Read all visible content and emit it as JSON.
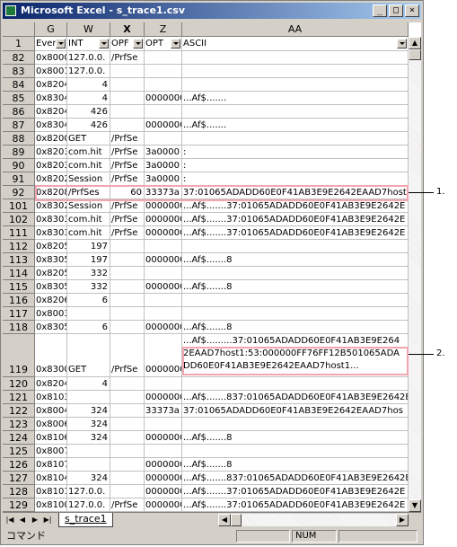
{
  "window": {
    "title": "Microsoft Excel - s_trace1.csv"
  },
  "columns": [
    {
      "label": "G",
      "selected": false
    },
    {
      "label": "W",
      "selected": false
    },
    {
      "label": "X",
      "selected": true
    },
    {
      "label": "Z",
      "selected": false
    },
    {
      "label": "AA",
      "selected": false
    }
  ],
  "header_row": {
    "num": "1",
    "cells": [
      "Even",
      "INT",
      "OPF",
      "OPT",
      "ASCII"
    ]
  },
  "rows": [
    {
      "num": "82",
      "g": "0x8000",
      "w": "127.0.0.",
      "x": "/PrfSe",
      "z": "",
      "aa": ""
    },
    {
      "num": "83",
      "g": "0x8001",
      "w": "127.0.0.",
      "x": "",
      "z": "",
      "aa": ""
    },
    {
      "num": "84",
      "g": "0x8204",
      "w": "4",
      "x": "",
      "z": "",
      "aa": ""
    },
    {
      "num": "85",
      "g": "0x8304",
      "w": "4",
      "x": "",
      "z": "0000000",
      "aa": "...Af$......."
    },
    {
      "num": "86",
      "g": "0x8204",
      "w": "426",
      "x": "",
      "z": "",
      "aa": ""
    },
    {
      "num": "87",
      "g": "0x8304",
      "w": "426",
      "x": "",
      "z": "0000000",
      "aa": "...Af$......."
    },
    {
      "num": "88",
      "g": "0x8200",
      "w": "GET",
      "x": "/PrfSe",
      "z": "",
      "aa": ""
    },
    {
      "num": "89",
      "g": "0x8203",
      "w": "com.hit",
      "x": "/PrfSe",
      "z": "3a0000",
      "aa": ":"
    },
    {
      "num": "90",
      "g": "0x8203",
      "w": "com.hit",
      "x": "/PrfSe",
      "z": "3a0000",
      "aa": ":"
    },
    {
      "num": "91",
      "g": "0x8202",
      "w": "Session",
      "x": "/PrfSe",
      "z": "3a0000",
      "aa": ":"
    },
    {
      "num": "92",
      "g": "0x8208",
      "w": "/PrfSes",
      "x": "60",
      "z": "33373a",
      "aa": "37:01065ADADD60E0F41AB3E9E2642EAAD7host"
    },
    {
      "num": "101",
      "g": "0x8302",
      "w": "Session",
      "x": "/PrfSe",
      "z": "0000000",
      "aa": "...Af$.......37:01065ADADD60E0F41AB3E9E2642E"
    },
    {
      "num": "102",
      "g": "0x8303",
      "w": "com.hit",
      "x": "/PrfSe",
      "z": "0000000",
      "aa": "...Af$.......37:01065ADADD60E0F41AB3E9E2642E"
    },
    {
      "num": "111",
      "g": "0x8303",
      "w": "com.hit",
      "x": "/PrfSe",
      "z": "0000000",
      "aa": "...Af$.......37:01065ADADD60E0F41AB3E9E2642E"
    },
    {
      "num": "112",
      "g": "0x8205",
      "w": "197",
      "x": "",
      "z": "",
      "aa": ""
    },
    {
      "num": "113",
      "g": "0x8305",
      "w": "197",
      "x": "",
      "z": "0000000",
      "aa": "...Af$.......8"
    },
    {
      "num": "114",
      "g": "0x8205",
      "w": "332",
      "x": "",
      "z": "",
      "aa": ""
    },
    {
      "num": "115",
      "g": "0x8305",
      "w": "332",
      "x": "",
      "z": "0000000",
      "aa": "...Af$.......8"
    },
    {
      "num": "116",
      "g": "0x8206",
      "w": "6",
      "x": "",
      "z": "",
      "aa": ""
    },
    {
      "num": "117",
      "g": "0x8003",
      "w": "",
      "x": "",
      "z": "",
      "aa": ""
    },
    {
      "num": "118",
      "g": "0x8305",
      "w": "6",
      "x": "",
      "z": "0000000",
      "aa": "...Af$.......8"
    },
    {
      "num": "119",
      "g": "0x8300",
      "w": "GET",
      "x": "/PrfSe",
      "z": "0000000",
      "aa": "...Af$.........37:01065ADADD60E0F41AB3E9E264 2EAAD7host1:53:000000FF76FF12B501065ADA DD60E0F41AB3E9E2642EAAD7host1..."
    },
    {
      "num": "120",
      "g": "0x8204",
      "w": "4",
      "x": "",
      "z": "",
      "aa": ""
    },
    {
      "num": "121",
      "g": "0x8103",
      "w": "",
      "x": "",
      "z": "0000000",
      "aa": "...Af$.......837:01065ADADD60E0F41AB3E9E2642E"
    },
    {
      "num": "122",
      "g": "0x8004",
      "w": "324",
      "x": "",
      "z": "33373a",
      "aa": "37:01065ADADD60E0F41AB3E9E2642EAAD7hos"
    },
    {
      "num": "123",
      "g": "0x8006",
      "w": "324",
      "x": "",
      "z": "",
      "aa": ""
    },
    {
      "num": "124",
      "g": "0x8106",
      "w": "324",
      "x": "",
      "z": "0000000",
      "aa": "...Af$.......8"
    },
    {
      "num": "125",
      "g": "0x8007",
      "w": "",
      "x": "",
      "z": "",
      "aa": ""
    },
    {
      "num": "126",
      "g": "0x8107",
      "w": "",
      "x": "",
      "z": "0000000",
      "aa": "...Af$.......8"
    },
    {
      "num": "127",
      "g": "0x8104",
      "w": "324",
      "x": "",
      "z": "0000000",
      "aa": "...Af$.......837:01065ADADD60E0F41AB3E9E2642E"
    },
    {
      "num": "128",
      "g": "0x8101",
      "w": "127.0.0.",
      "x": "",
      "z": "0000000",
      "aa": "...Af$.......37:01065ADADD60E0F41AB3E9E2642E"
    },
    {
      "num": "129",
      "g": "0x8100",
      "w": "127.0.0.",
      "x": "/PrfSe",
      "z": "0000000",
      "aa": "...Af$.......37:01065ADADD60E0F41AB3E9E2642E"
    }
  ],
  "sheet_tab": "s_trace1",
  "status": {
    "mode": "コマンド",
    "num": "NUM"
  },
  "callouts": {
    "one": "1.",
    "two": "2."
  },
  "colors": {
    "highlight": "#f3a6b0",
    "title_bar": "#0a246a"
  },
  "icons": {
    "close": "close-icon",
    "minimize": "minimize-icon",
    "maximize": "maximize-icon",
    "app": "excel-icon"
  }
}
